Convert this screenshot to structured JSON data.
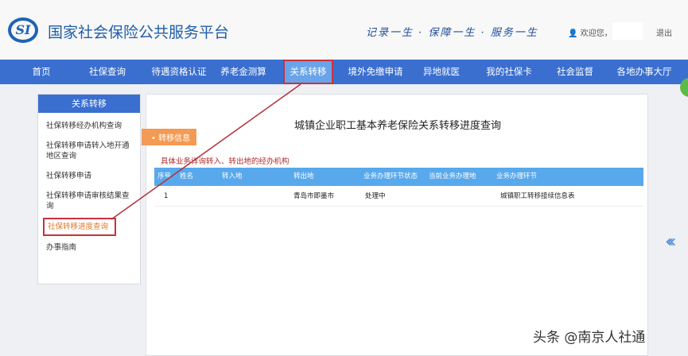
{
  "header": {
    "logo_text": "SI",
    "title": "国家社会保险公共服务平台",
    "slogan": "记录一生 · 保障一生 · 服务一生",
    "welcome": "欢迎您，",
    "logout": "退出"
  },
  "nav": [
    "首页",
    "社保查询",
    "待遇资格认证",
    "养老金测算",
    "关系转移",
    "境外免缴申请",
    "异地就医",
    "我的社保卡",
    "社会监督",
    "各地办事大厅"
  ],
  "sidebar": {
    "title": "关系转移",
    "items": [
      "社保转移经办机构查询",
      "社保转移申请转入地开通地区查询",
      "社保转移申请",
      "社保转移申请审核结果查询",
      "社保转移进度查询",
      "办事指南"
    ]
  },
  "main": {
    "title": "城镇企业职工基本养老保险关系转移进度查询",
    "tag": "转移信息",
    "note": "具体业务详询转入、转出地的经办机构",
    "columns": [
      "序号",
      "姓名",
      "转入地",
      "转出地",
      "业务办理环节状态",
      "当前业务办理地",
      "业务办理环节"
    ],
    "rows": [
      [
        "1",
        "",
        "",
        "青岛市即墨市",
        "处理中",
        "",
        "城镇职工转移接续信息表"
      ]
    ]
  },
  "watermark": "头条 @南京人社通"
}
